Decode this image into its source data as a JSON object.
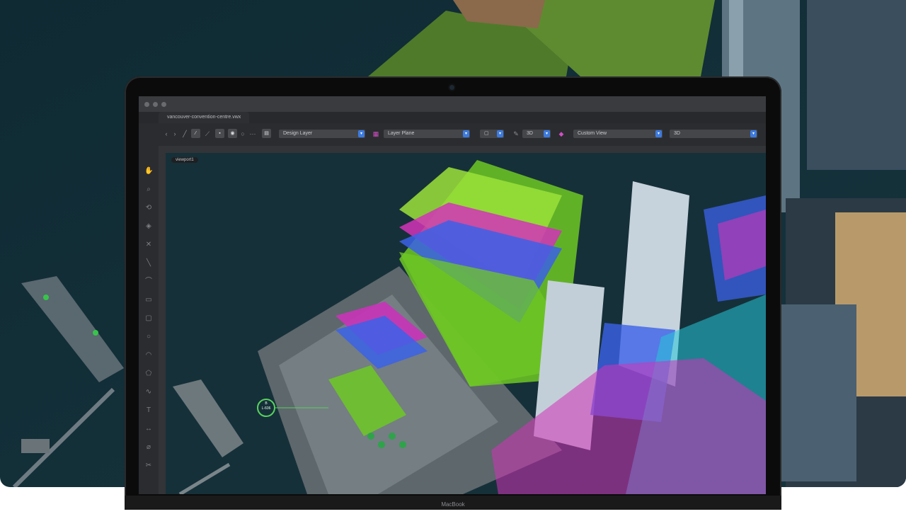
{
  "window": {
    "document_tab": "vancouver-convention-centre.vwx"
  },
  "toolbar": {
    "design_layer": "Design Layer",
    "layer_plane": "Layer Plane",
    "view_mode": "3D",
    "saved_view": "Custom View",
    "render_mode": "3D",
    "caret": "▾"
  },
  "viewport": {
    "label": "viewport1",
    "marker_top": "B",
    "marker_bottom": "L-606"
  },
  "device": {
    "brand": "MacBook"
  },
  "colors": {
    "accent": "#3c7be0",
    "green_overlay": "#7ed321",
    "magenta_overlay": "#d633c4",
    "blue_overlay": "#3b6cf0",
    "cyan_overlay": "#27c6d9"
  }
}
